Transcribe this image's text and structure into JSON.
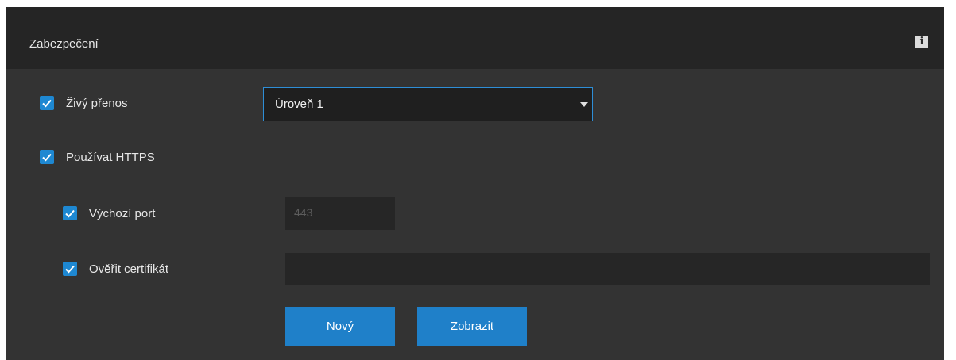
{
  "panel": {
    "title": "Zabezpečení",
    "info_icon": "info-icon",
    "info_glyph": "i"
  },
  "colors": {
    "accent": "#1e88d2",
    "panel_bg": "#333333",
    "header_bg": "#252525",
    "input_bg": "#262626"
  },
  "settings": {
    "live_stream": {
      "label": "Živý přenos",
      "checked": true,
      "level_value": "Úroveň 1"
    },
    "use_https": {
      "label": "Používat HTTPS",
      "checked": true
    },
    "default_port": {
      "label": "Výchozí port",
      "checked": true,
      "value": "443"
    },
    "verify_certificate": {
      "label": "Ověřit certifikát",
      "checked": true,
      "value": ""
    }
  },
  "buttons": {
    "new_label": "Nový",
    "show_label": "Zobrazit"
  }
}
